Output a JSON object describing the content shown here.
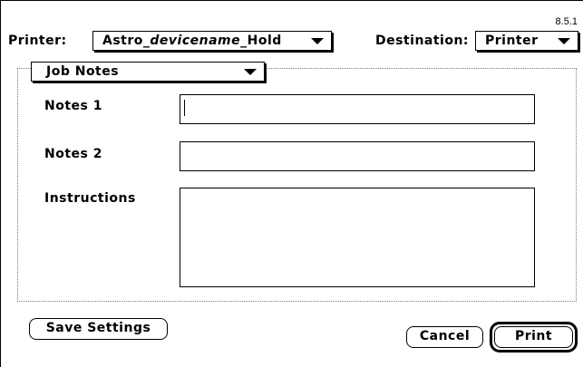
{
  "version": "8.5.1",
  "printer": {
    "label": "Printer:",
    "value_prefix": "Astro_",
    "value_italic": "devicename",
    "value_suffix": "_Hold"
  },
  "destination": {
    "label": "Destination:",
    "value": "Printer"
  },
  "panel": {
    "selected": "Job Notes"
  },
  "fields": {
    "notes1_label": "Notes 1",
    "notes1_value": "",
    "notes2_label": "Notes 2",
    "notes2_value": "",
    "instructions_label": "Instructions",
    "instructions_value": ""
  },
  "buttons": {
    "save_settings": "Save Settings",
    "cancel": "Cancel",
    "print": "Print"
  }
}
